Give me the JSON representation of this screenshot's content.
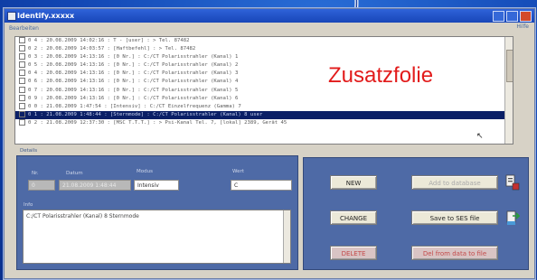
{
  "window": {
    "title": "Identify.xxxxx"
  },
  "header": {
    "left_label": "Bearbeiten",
    "right_label": "Hilfe"
  },
  "list": {
    "rows": [
      "0  4 : 20.08.2009 14:02:16 : T - [user] : > Tel. 87482",
      "0  2 : 20.08.2009 14:03:57 : [Haftbefehl] : > Tel. 87482",
      "0  3 : 20.08.2009 14:13:16 : [0 Nr.] : C:/CT Polarisstrahler (Kanal) 1",
      "0  5 : 20.08.2009 14:13:16 : [0 Nr.] : C:/CT Polarisstrahler (Kanal) 2",
      "0  4 : 20.08.2009 14:13:16 : [0 Nr.] : C:/CT Polarisstrahler (Kanal) 3",
      "0  6 : 20.08.2009 14:13:16 : [0 Nr.] : C:/CT Polarisstrahler (Kanal) 4",
      "0  7 : 20.08.2009 14:13:16 : [0 Nr.] : C:/CT Polarisstrahler (Kanal) 5",
      "0  9 : 20.08.2009 14:13:16 : [0 Nr.] : C:/CT Polarisstrahler (Kanal) 6",
      "0  0 : 21.08.2009 1:47:54 : [Intensiv] : C:/CT Einzelfrequenz (Gamma) 7",
      "0  1 : 21.08.2009 1:48:44 : [Sternmode] : C:/CT Polarisstrahler (Kanal) 8 user",
      "0  2 : 21.08.2009 12:37:30 : [MSC T.T.T.] : > Psi-Kanal Tel. 7, [lokal] 2389, Gerät 45"
    ],
    "selected_index": 9
  },
  "overlay_text": "Zusatzfolie",
  "detail": {
    "section_label": "Details",
    "labels": {
      "nr": "Nr.",
      "datum": "Datum",
      "typ": "Modus",
      "wert": "Wert"
    },
    "nr_value": "0",
    "datum_value": "21.08.2009 1:48:44",
    "typ_value": "Intensiv",
    "wert_value": "C",
    "memo_label": "Info",
    "memo_value": "C:/CT Polarisstrahler (Kanal) 8 Sternmode"
  },
  "actions": {
    "new_label": "NEW",
    "change_label": "CHANGE",
    "delete_label": "DELETE",
    "add_label": "Add to database",
    "save_label": "Save to SES file",
    "reset_label": "Del from data to file"
  },
  "colors": {
    "selection": "#0a1f66",
    "overlay_text": "#e21b1b",
    "panel": "#4e6aa6"
  }
}
